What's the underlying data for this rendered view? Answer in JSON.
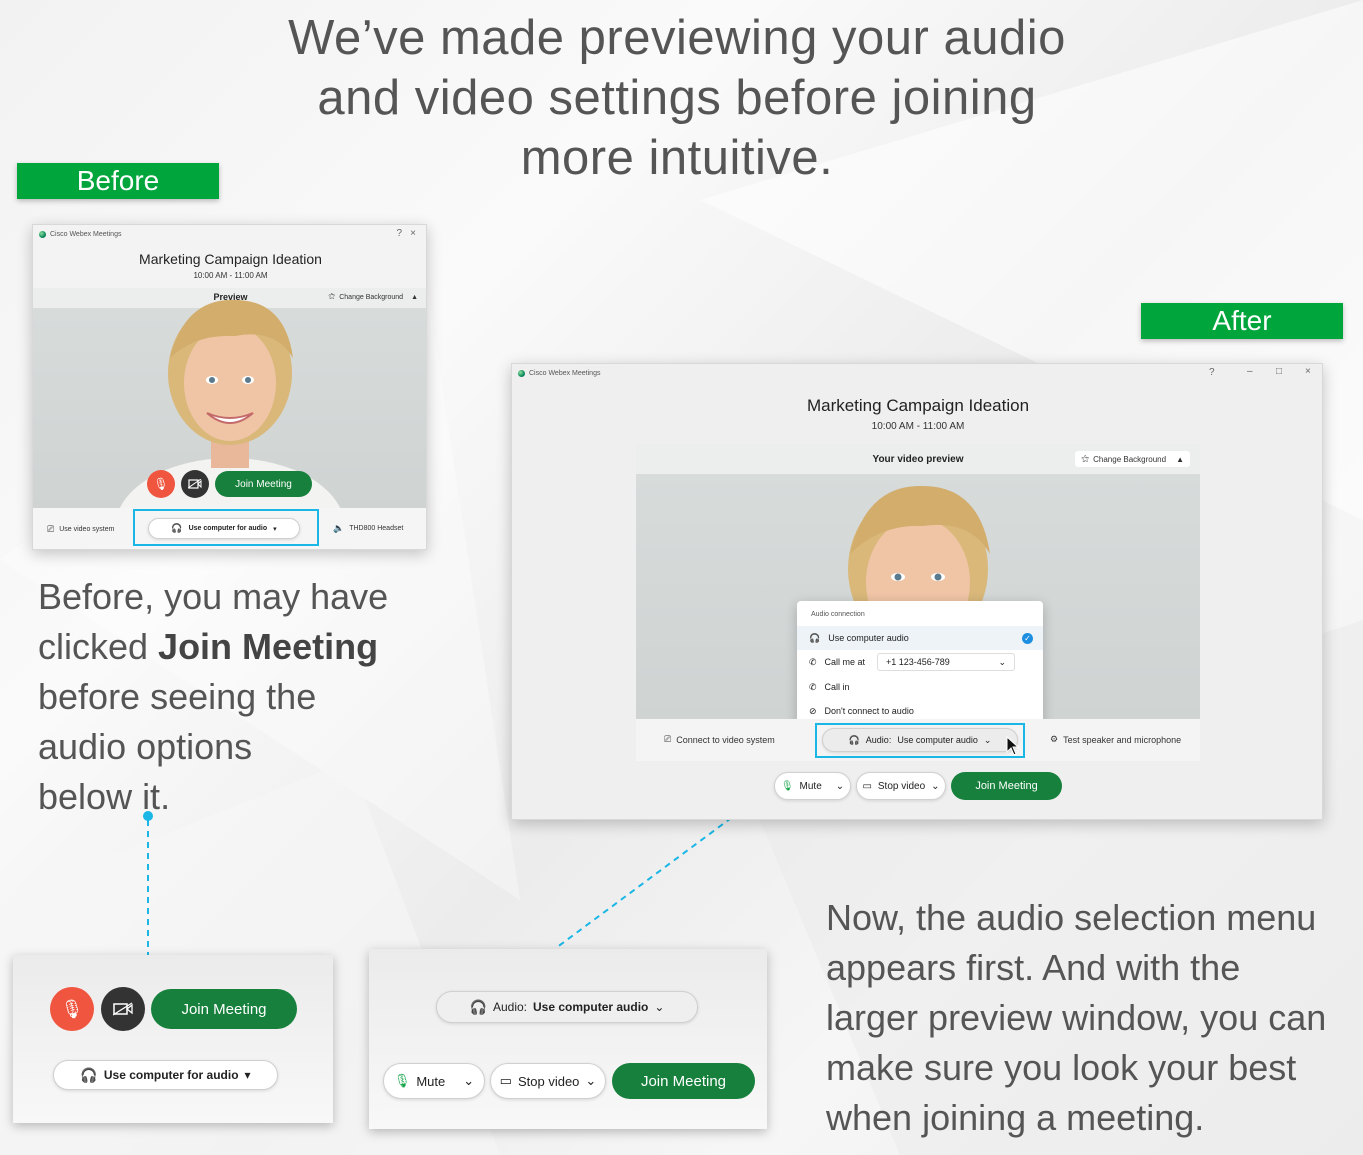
{
  "headline": {
    "line1": "We’ve made previewing your audio",
    "line2": "and video settings before joining",
    "line3": "more intuitive."
  },
  "before": {
    "tag": "Before",
    "window": {
      "app_name": "Cisco Webex Meetings",
      "meeting_title": "Marketing Campaign Ideation",
      "meeting_time": "10:00 AM - 11:00 AM",
      "preview_label": "Preview",
      "change_background": "Change Background",
      "join_label": "Join Meeting",
      "use_video_system": "Use video system",
      "use_computer_audio": "Use computer for audio",
      "headset": "THD800 Headset"
    },
    "caption": {
      "line1": "Before, you may have",
      "line2a": "clicked ",
      "line2b": "Join Meeting",
      "line3": "before seeing the",
      "line4": "audio options",
      "line5": "below it."
    },
    "zoom": {
      "join_label": "Join Meeting",
      "audio_label": "Use computer for audio"
    }
  },
  "after": {
    "tag": "After",
    "window": {
      "app_name": "Cisco Webex Meetings",
      "meeting_title": "Marketing Campaign Ideation",
      "meeting_time": "10:00 AM - 11:00 AM",
      "preview_label": "Your video preview",
      "change_background": "Change Background",
      "connect_video_system": "Connect to video system",
      "audio_prefix": "Audio:",
      "audio_value": "Use computer audio",
      "test_speaker": "Test speaker and microphone",
      "mute_label": "Mute",
      "stop_video_label": "Stop video",
      "join_label": "Join Meeting"
    },
    "audio_menu": {
      "header": "Audio connection",
      "items": [
        {
          "label": "Use computer audio"
        },
        {
          "label": "Call me at",
          "number": "+1 123-456-789"
        },
        {
          "label": "Call in"
        },
        {
          "label": "Don't connect to audio"
        }
      ]
    },
    "zoom": {
      "audio_prefix": "Audio:",
      "audio_value": "Use computer audio",
      "mute_label": "Mute",
      "stop_video_label": "Stop video",
      "join_label": "Join Meeting"
    },
    "caption": {
      "line1": "Now, the audio selection menu",
      "line2": "appears first.  And with the",
      "line3": "larger preview window, you can",
      "line4": "make sure you look your best",
      "line5": "when joining a meeting."
    }
  },
  "colors": {
    "green_tag": "#00a53c",
    "join_green": "#16803c",
    "highlight_blue": "#1ab6e6",
    "mute_red": "#f0553f"
  }
}
